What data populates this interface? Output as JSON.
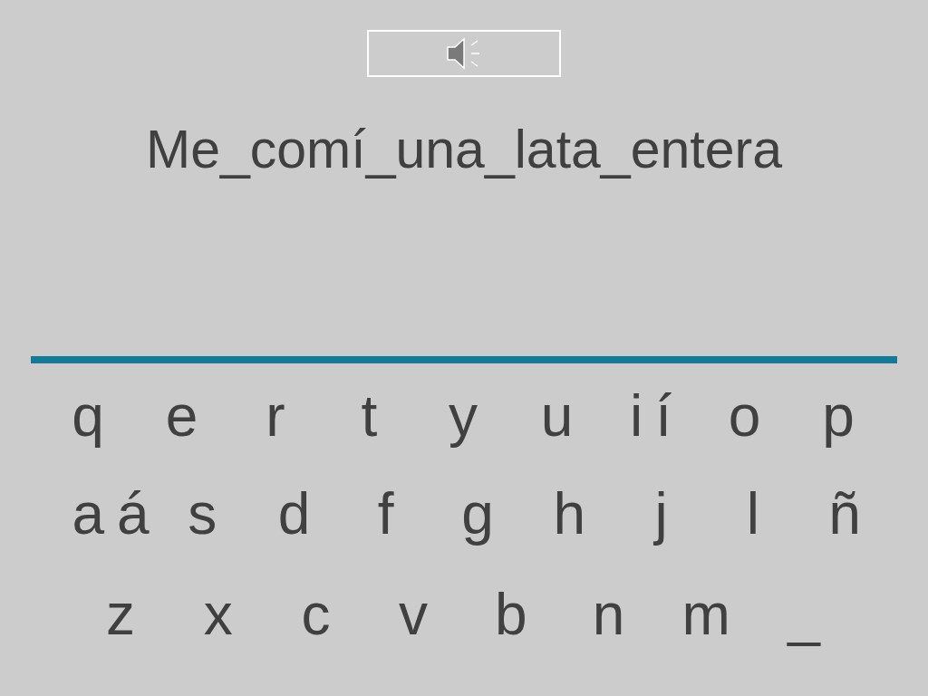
{
  "prompt": "Me_comí_una_lata_entera",
  "keyboard": {
    "rows": [
      [
        [
          "q"
        ],
        [
          "e"
        ],
        [
          "r"
        ],
        [
          "t"
        ],
        [
          "y"
        ],
        [
          "u"
        ],
        [
          "i",
          "í"
        ],
        [
          "o"
        ],
        [
          "p"
        ]
      ],
      [
        [
          "a",
          "á"
        ],
        [
          "s"
        ],
        [
          "d"
        ],
        [
          "f"
        ],
        [
          "g"
        ],
        [
          "h"
        ],
        [
          "j"
        ],
        [
          "l"
        ],
        [
          "ñ"
        ]
      ],
      [
        [
          "z"
        ],
        [
          "x"
        ],
        [
          "c"
        ],
        [
          "v"
        ],
        [
          "b"
        ],
        [
          "n"
        ],
        [
          "m"
        ],
        [
          "_"
        ]
      ]
    ]
  }
}
